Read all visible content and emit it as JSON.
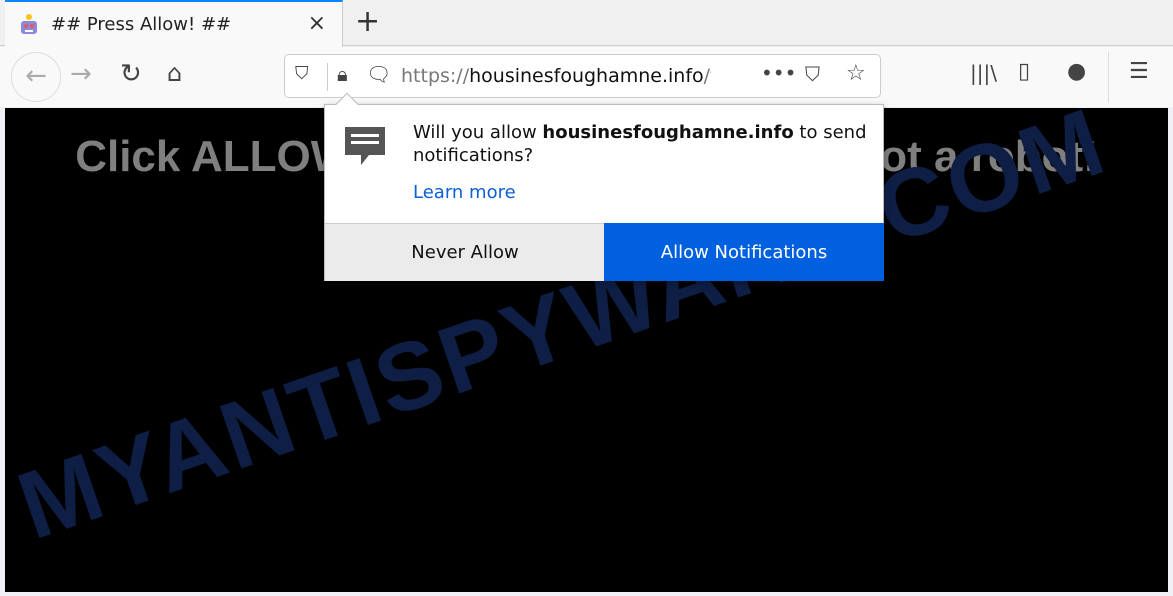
{
  "tab": {
    "title": "## Press Allow! ##",
    "close": "×",
    "new_tab": "+"
  },
  "url": {
    "scheme": "https://",
    "host": "housinesfoughamne.info",
    "path": "/f"
  },
  "page": {
    "headline": "Click ALLOW to confirm that you are not a robot!",
    "watermark": "MYANTISPYWARE.COM"
  },
  "popup": {
    "prefix": "Will you allow ",
    "site": "housinesfoughamne.info",
    "suffix": " to send notifications?",
    "learn_more": "Learn more",
    "never_allow": "Never Allow",
    "allow": "Allow Notifications"
  },
  "colors": {
    "accent": "#0060df",
    "page_bg": "#000000"
  }
}
